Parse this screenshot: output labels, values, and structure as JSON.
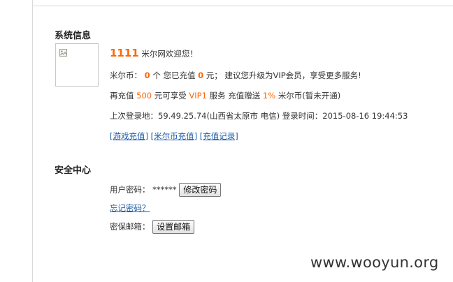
{
  "system_info": {
    "title": "系统信息",
    "username": "1111",
    "welcome": "米尔网欢迎您！",
    "coin_line": {
      "prefix": "米尔币：",
      "coins": "0",
      "mid": "个 您已充值",
      "recharged": "0",
      "suffix": "元； 建议您升级为VIP会员，享受更多服务!"
    },
    "promo_line": {
      "prefix": "再充值",
      "amount": "500",
      "mid1": "元可享受",
      "vip": "VIP1",
      "mid2": "服务 充值赠送",
      "percent": "1%",
      "suffix": "米尔币(暂未开通)"
    },
    "login_line": "上次登录地：59.49.25.74(山西省太原市 电信) 登录时间：2015-08-16 19:44:53",
    "links": [
      "[游戏充值]",
      "[米尔币充值]",
      "[充值记录]"
    ]
  },
  "security": {
    "title": "安全中心",
    "password_label": "用户密码：",
    "password_mask": "******",
    "change_password": "修改密码",
    "forgot_password": "忘记密码？",
    "email_label": "密保邮箱：",
    "set_email": "设置邮箱"
  },
  "watermark": "www.wooyun.org",
  "colors": {
    "accent": "#ff6600",
    "link": "#1a5aa8"
  }
}
